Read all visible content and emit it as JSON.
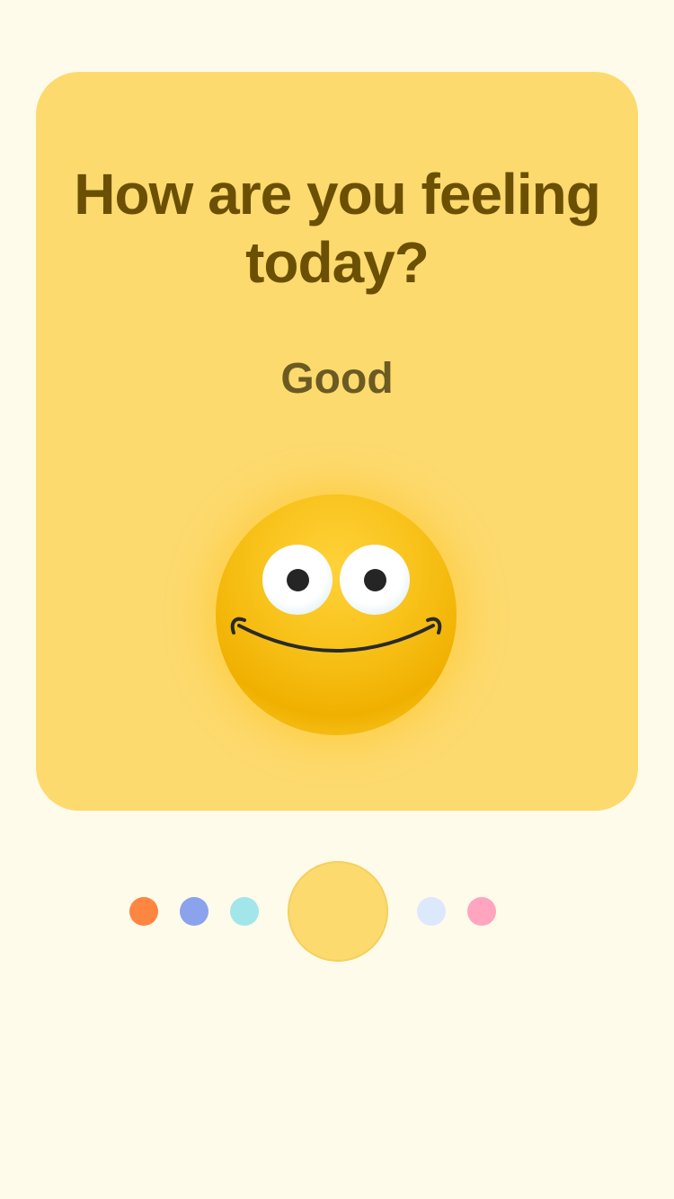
{
  "card": {
    "question": "How are you feeling today?",
    "mood_label": "Good",
    "background_color": "#FDDA6E"
  },
  "face": {
    "mood": "good",
    "icon": "smiling-face-icon"
  },
  "mood_selector": {
    "options": [
      {
        "mood": "dot-1",
        "color": "#FF8640",
        "selected": false
      },
      {
        "mood": "dot-2",
        "color": "#8BA3EC",
        "selected": false
      },
      {
        "mood": "dot-3",
        "color": "#A3E6EA",
        "selected": false
      },
      {
        "mood": "good",
        "color": "#FDDA6E",
        "selected": true
      },
      {
        "mood": "dot-5",
        "color": "#DCE8FB",
        "selected": false
      },
      {
        "mood": "dot-6",
        "color": "#FFA5BF",
        "selected": false
      }
    ]
  },
  "colors": {
    "page_background": "#FFFBEB",
    "question_text": "#6B5004",
    "label_text": "#6B5A22"
  }
}
